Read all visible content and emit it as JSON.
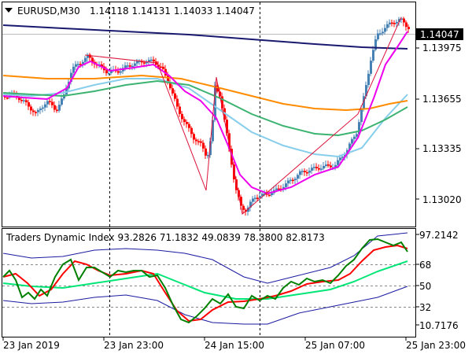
{
  "header": {
    "symbol_label": "EURUSD,M30",
    "ohlc": "1.14118 1.14131 1.14033 1.14047"
  },
  "indicator": {
    "title": "Traders Dynamic Index 93.2826 71.1832 49.0839 78.3800 82.8173"
  },
  "price_scale": {
    "current_price": "1.14047",
    "ticks": [
      "1.13975",
      "1.13655",
      "1.13335",
      "1.13020"
    ]
  },
  "indicator_scale": {
    "ticks": [
      "97.2142",
      "68",
      "50",
      "32",
      "10.7176"
    ]
  },
  "time_scale": {
    "ticks": [
      "23 Jan 2019",
      "23 Jan 23:00",
      "24 Jan 15:00",
      "25 Jan 07:00",
      "25 Jan 23:00"
    ]
  },
  "colors": {
    "bull": "#4682b4",
    "bear": "#ff0000",
    "ma_navy": "#191970",
    "ma_orange": "#ff8c00",
    "ma_green": "#3cb371",
    "ma_lightblue": "#87ceeb",
    "ma_magenta": "#ee00ee",
    "zigzag": "#dc143c",
    "tdi_green": "#008000",
    "tdi_red": "#ff0000",
    "tdi_signal": "#00e676",
    "tdi_band": "#1a1aa0"
  }
}
